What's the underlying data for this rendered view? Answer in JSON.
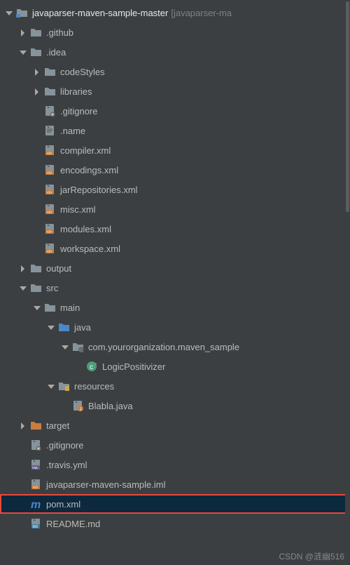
{
  "root": {
    "name": "javaparser-maven-sample-master",
    "annotation": "[javaparser-ma"
  },
  "github": ".github",
  "idea": ".idea",
  "codeStyles": "codeStyles",
  "libraries": "libraries",
  "idea_gitignore": ".gitignore",
  "idea_name": ".name",
  "compiler": "compiler.xml",
  "encodings": "encodings.xml",
  "jarRepositories": "jarRepositories.xml",
  "misc": "misc.xml",
  "modules": "modules.xml",
  "workspace": "workspace.xml",
  "output": "output",
  "src": "src",
  "main": "main",
  "java": "java",
  "package": "com.yourorganization.maven_sample",
  "classLogic": "LogicPositivizer",
  "resources": "resources",
  "blabla": "Blabla.java",
  "target": "target",
  "root_gitignore": ".gitignore",
  "travis": ".travis.yml",
  "iml": "javaparser-maven-sample.iml",
  "pom": "pom.xml",
  "readme": "README.md",
  "watermark": "CSDN @涟幽516"
}
